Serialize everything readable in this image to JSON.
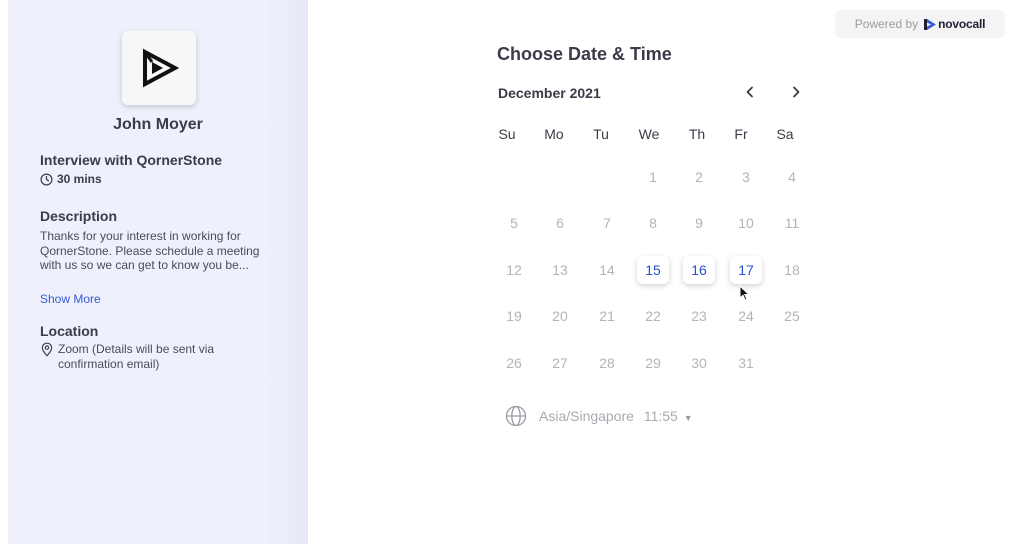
{
  "host": {
    "name": "John Moyer",
    "logo_icon": "play-triangle-logo-icon"
  },
  "event": {
    "title": "Interview with QornerStone",
    "duration": "30 mins"
  },
  "description": {
    "heading": "Description",
    "text": "Thanks for your interest in working for QornerStone. Please schedule a meeting with us so we can get to know you be...",
    "show_more": "Show More"
  },
  "location": {
    "heading": "Location",
    "text": "Zoom (Details will be sent via confirmation email)"
  },
  "powered": {
    "label": "Powered by",
    "brand": "novocall"
  },
  "calendar": {
    "title": "Choose Date & Time",
    "month": "December 2021",
    "weekdays": [
      "Su",
      "Mo",
      "Tu",
      "We",
      "Th",
      "Fr",
      "Sa"
    ],
    "days": [
      "1",
      "2",
      "3",
      "4",
      "5",
      "6",
      "7",
      "8",
      "9",
      "10",
      "11",
      "12",
      "13",
      "14",
      "15",
      "16",
      "17",
      "18",
      "19",
      "20",
      "21",
      "22",
      "23",
      "24",
      "25",
      "26",
      "27",
      "28",
      "29",
      "30",
      "31"
    ],
    "available_days": [
      "15",
      "16",
      "17"
    ],
    "first_weekday_index": 3
  },
  "timezone": {
    "name": "Asia/Singapore",
    "time": "11:55"
  },
  "colors": {
    "accent": "#2a4fcf",
    "link": "#3a5bd9",
    "panel_bg": "#eef0fb",
    "disabled_day": "#b2b4ba"
  }
}
